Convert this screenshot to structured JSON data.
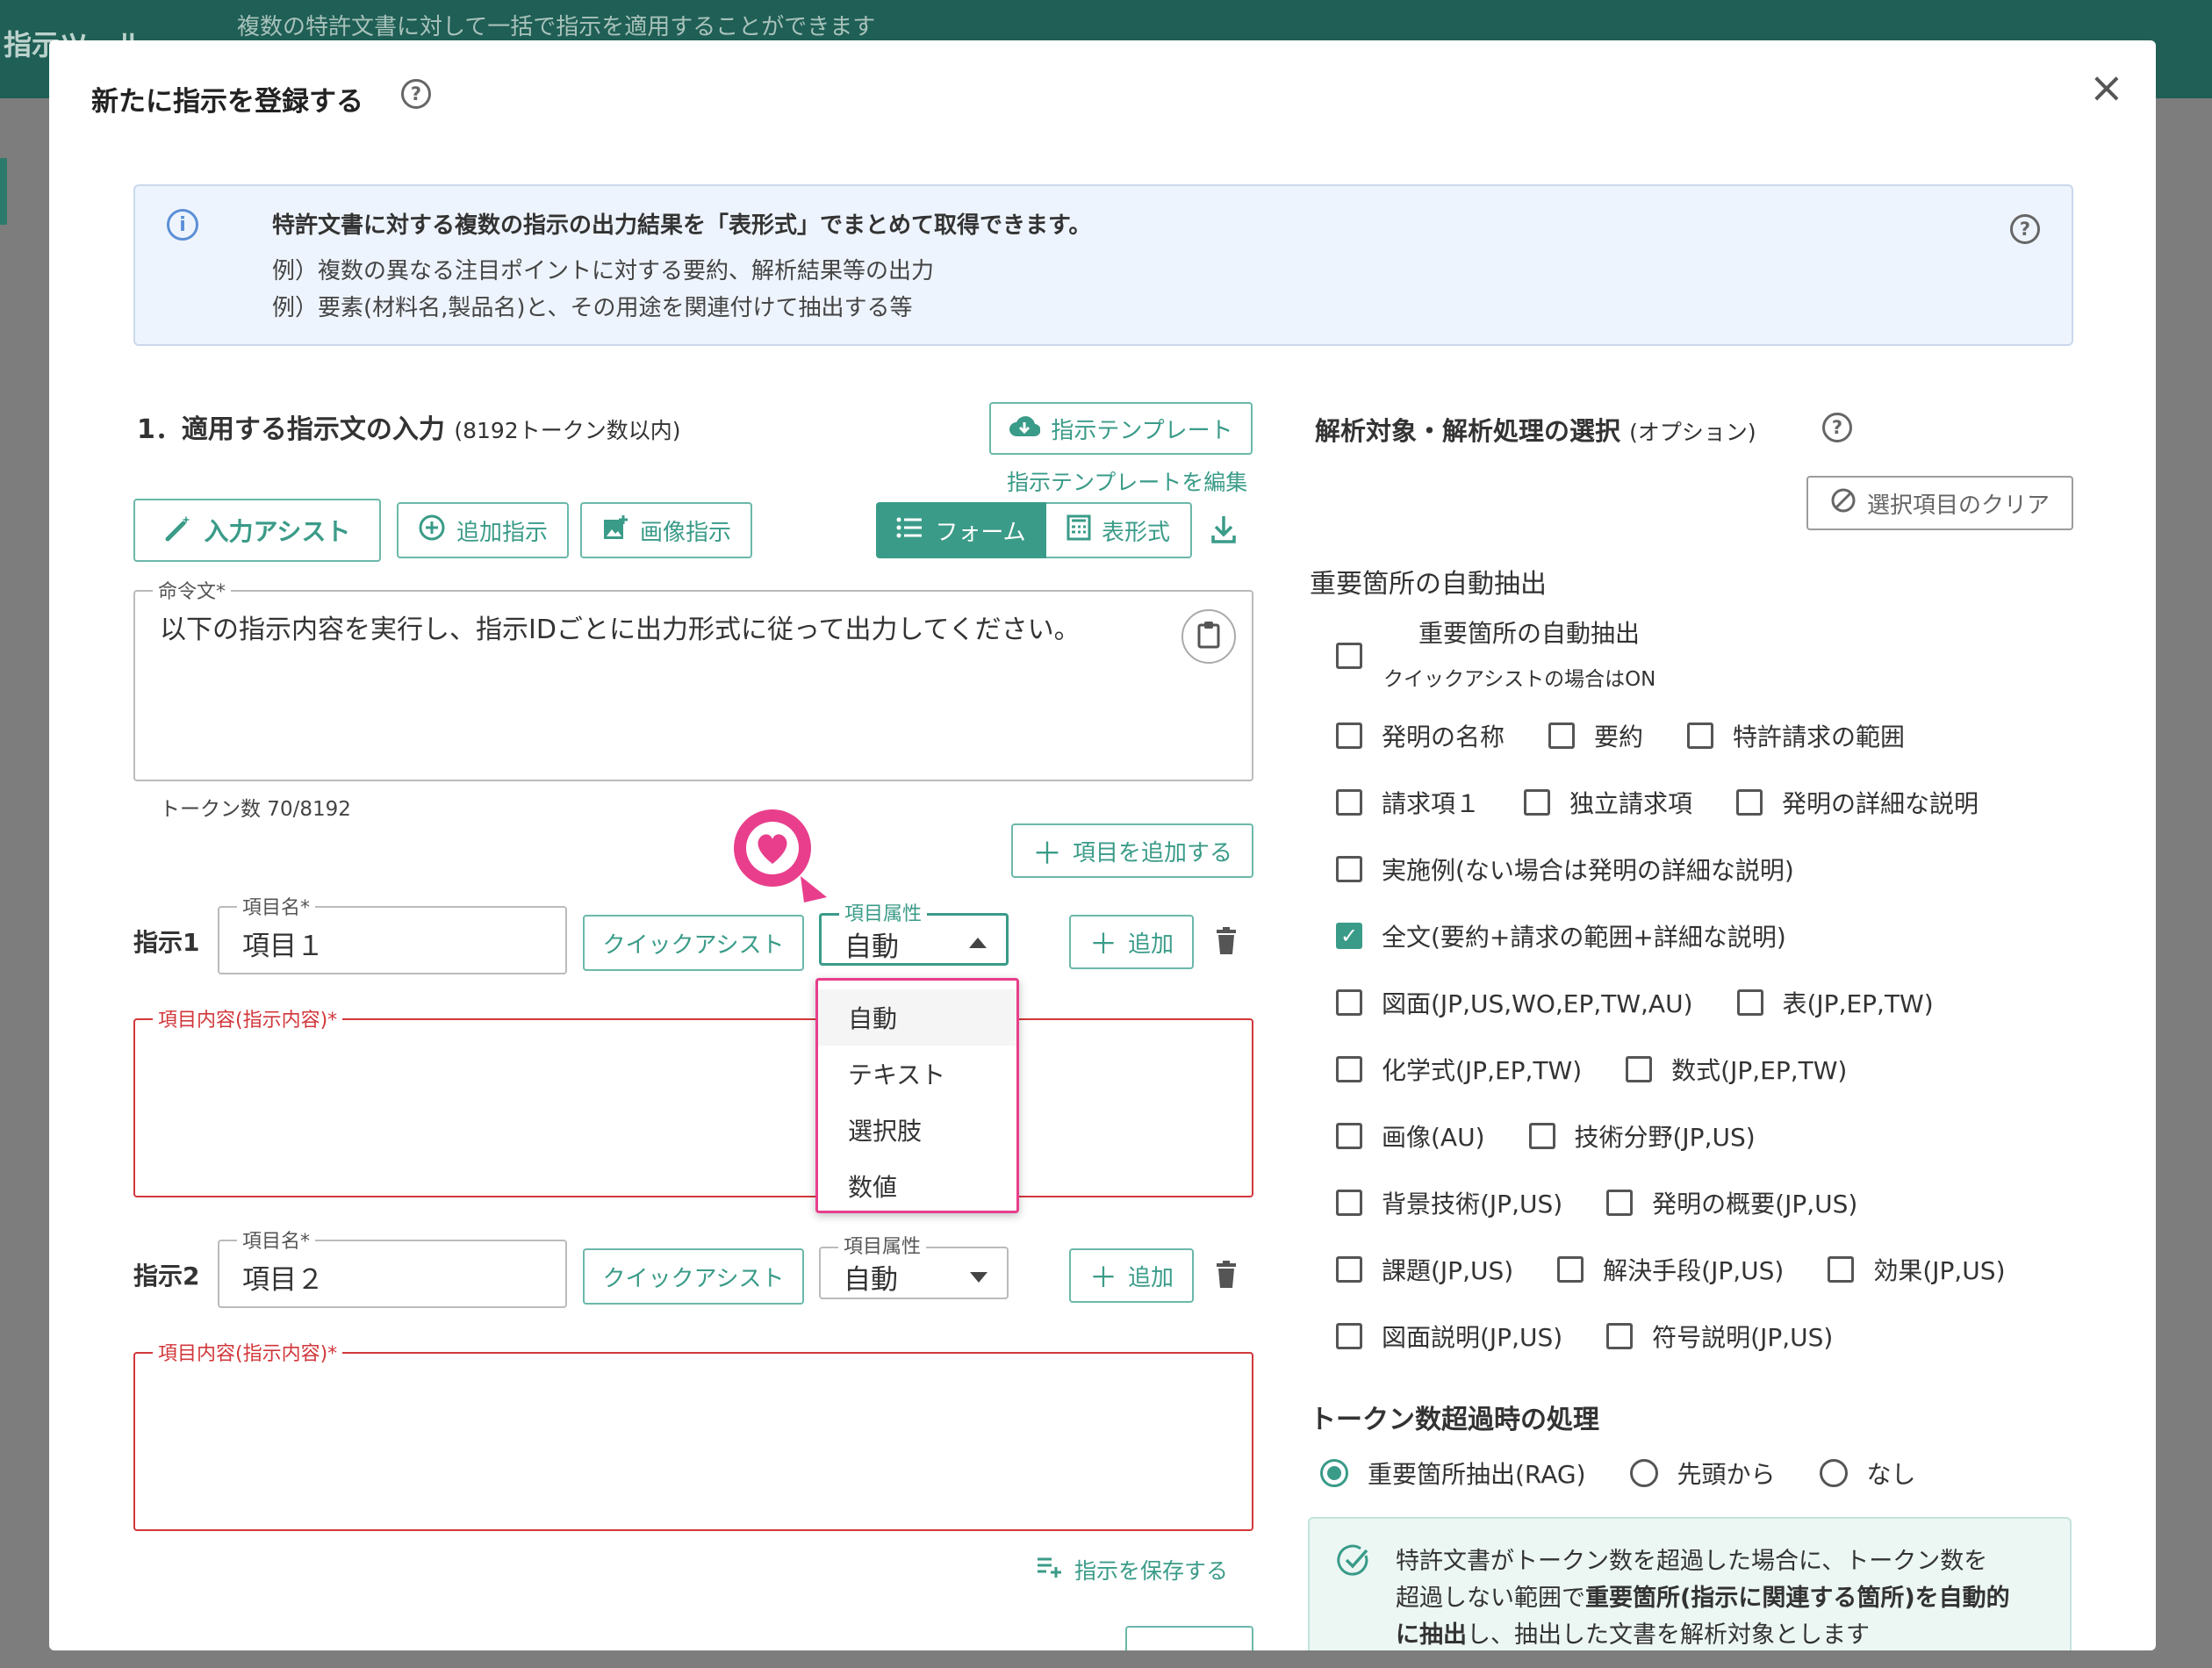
{
  "background": {
    "app_title": "指示ツール",
    "subtitle": "複数の特許文書に対して一括で指示を適用することができます"
  },
  "modal": {
    "title": "新たに指示を登録する",
    "close_label": "×"
  },
  "info": {
    "main": "特許文書に対する複数の指示の出力結果を「表形式」でまとめて取得できます。",
    "example1": "例）複数の異なる注目ポイントに対する要約、解析結果等の出力",
    "example2": "例）要素(材料名,製品名)と、その用途を関連付けて抽出する等"
  },
  "section1": {
    "title": "1．適用する指示文の入力",
    "title_note": "(8192トークン数以内)",
    "template_button": "指示テンプレート",
    "edit_template_link": "指示テンプレートを編集",
    "input_assist": "入力アシスト",
    "add_instruction": "追加指示",
    "image_instruction": "画像指示",
    "view_form": "フォーム",
    "view_table": "表形式"
  },
  "command": {
    "legend": "命令文*",
    "text": "以下の指示内容を実行し、指示IDごとに出力形式に従って出力してください。",
    "token_count": "トークン数 70/8192"
  },
  "add_item_button": "項目を追加する",
  "instructions": [
    {
      "label": "指示1",
      "name_legend": "項目名*",
      "name_value": "項目１",
      "quick_assist": "クイックアシスト",
      "attr_legend": "項目属性",
      "attr_value": "自動",
      "add_label": "追加",
      "content_legend": "項目内容(指示内容)*"
    },
    {
      "label": "指示2",
      "name_legend": "項目名*",
      "name_value": "項目２",
      "quick_assist": "クイックアシスト",
      "attr_legend": "項目属性",
      "attr_value": "自動",
      "add_label": "追加",
      "content_legend": "項目内容(指示内容)*"
    }
  ],
  "attr_dropdown": {
    "options": [
      "自動",
      "テキスト",
      "選択肢",
      "数値"
    ],
    "selected": "自動"
  },
  "save_instruction": "指示を保存する",
  "right": {
    "title": "解析対象・解析処理の選択",
    "title_note": "(オプション)",
    "clear_button": "選択項目のクリア",
    "auto_extract_heading": "重要箇所の自動抽出",
    "auto_extract_label": "重要箇所の自動抽出",
    "auto_extract_note": "クイックアシストの場合はON",
    "checkboxes": [
      {
        "label": "発明の名称",
        "checked": false
      },
      {
        "label": "要約",
        "checked": false
      },
      {
        "label": "特許請求の範囲",
        "checked": false
      },
      {
        "label": "請求項１",
        "checked": false
      },
      {
        "label": "独立請求項",
        "checked": false
      },
      {
        "label": "発明の詳細な説明",
        "checked": false
      },
      {
        "label": "実施例(ない場合は発明の詳細な説明)",
        "checked": false
      },
      {
        "label": "全文(要約+請求の範囲+詳細な説明)",
        "checked": true
      },
      {
        "label": "図面(JP,US,WO,EP,TW,AU)",
        "checked": false
      },
      {
        "label": "表(JP,EP,TW)",
        "checked": false
      },
      {
        "label": "化学式(JP,EP,TW)",
        "checked": false
      },
      {
        "label": "数式(JP,EP,TW)",
        "checked": false
      },
      {
        "label": "画像(AU)",
        "checked": false
      },
      {
        "label": "技術分野(JP,US)",
        "checked": false
      },
      {
        "label": "背景技術(JP,US)",
        "checked": false
      },
      {
        "label": "発明の概要(JP,US)",
        "checked": false
      },
      {
        "label": "課題(JP,US)",
        "checked": false
      },
      {
        "label": "解決手段(JP,US)",
        "checked": false
      },
      {
        "label": "効果(JP,US)",
        "checked": false
      },
      {
        "label": "図面説明(JP,US)",
        "checked": false
      },
      {
        "label": "符号説明(JP,US)",
        "checked": false
      }
    ],
    "token_heading": "トークン数超過時の処理",
    "radios": [
      {
        "label": "重要箇所抽出(RAG)",
        "selected": true
      },
      {
        "label": "先頭から",
        "selected": false
      },
      {
        "label": "なし",
        "selected": false
      }
    ],
    "note_line1": "特許文書がトークン数を超過した場合に、トークン数を",
    "note_line2_pre": "超過しない範囲で",
    "note_line2_bold": "重要箇所(指示に関連する箇所)を自動的",
    "note_line3_bold": "に抽出",
    "note_line3_post": "し、抽出した文書を解析対象とします"
  },
  "colors": {
    "accent": "#3a9b88",
    "error": "#d2373b",
    "highlight": "#e83e8c",
    "info_bg": "#eef4fd"
  }
}
